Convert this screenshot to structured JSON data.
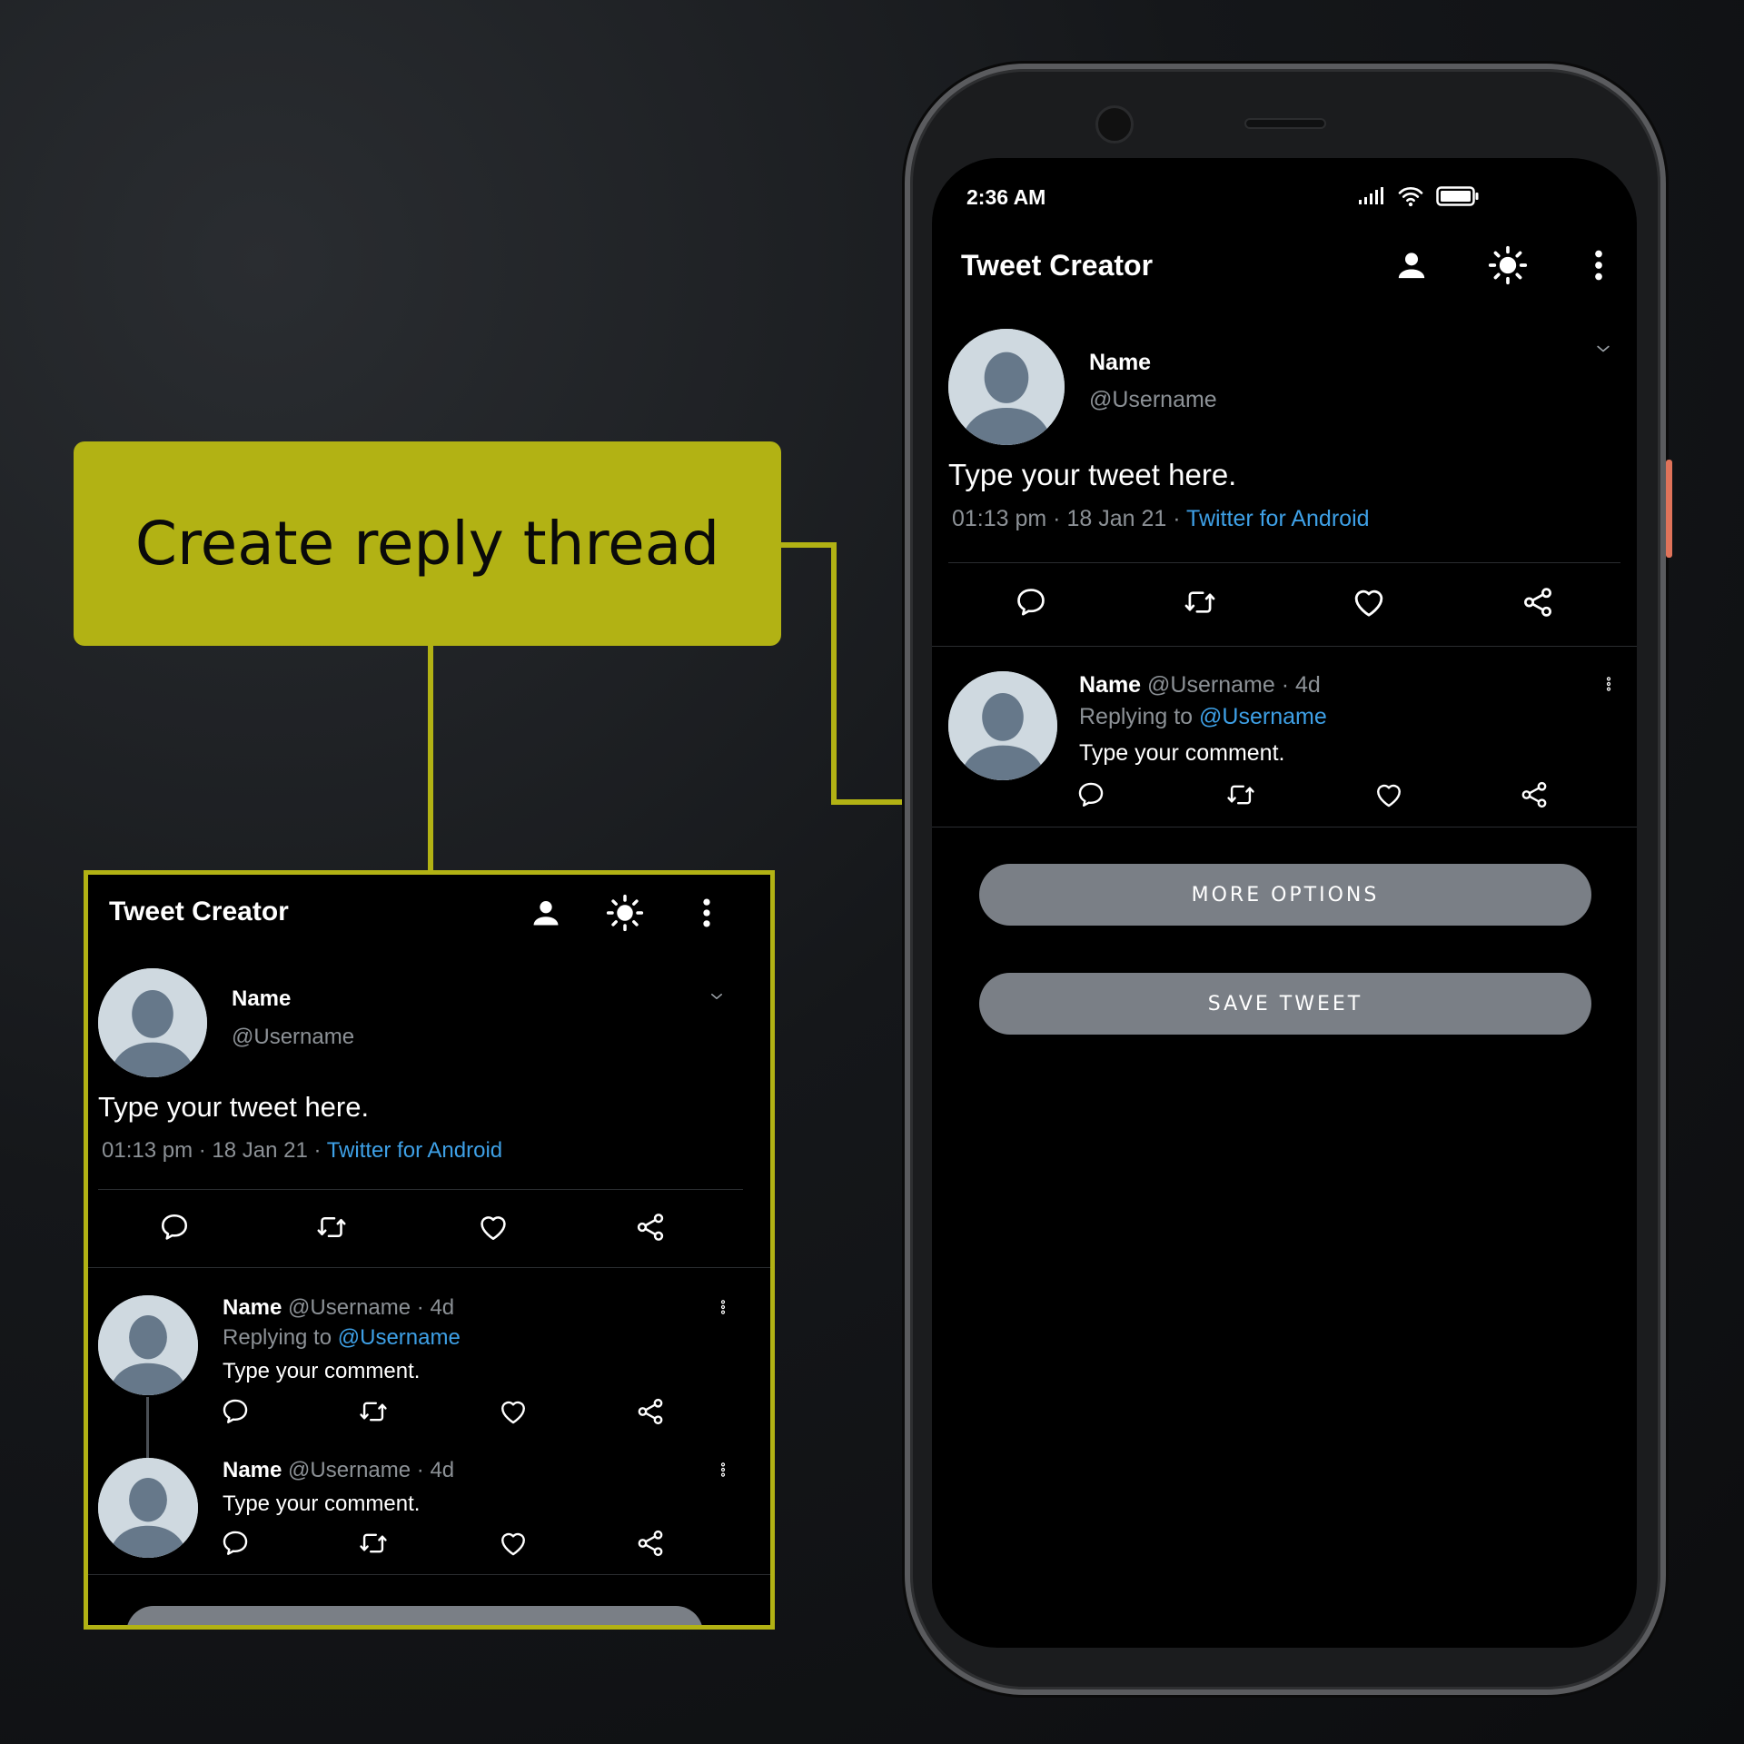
{
  "callout": {
    "text": "Create reply thread"
  },
  "colors": {
    "accent": "#b2b214",
    "link": "#3ea0e6",
    "button": "#7a7f86"
  },
  "status_bar": {
    "time": "2:36 AM"
  },
  "app": {
    "title": "Tweet Creator",
    "toolbar_icons": [
      "person-icon",
      "brightness-icon",
      "more-vert-icon"
    ]
  },
  "main_tweet": {
    "name": "Name",
    "username": "@Username",
    "text": "Type your tweet here.",
    "time": "01:13 pm · 18 Jan 21 · ",
    "source": "Twitter for Android"
  },
  "reply": {
    "name": "Name",
    "meta": "@Username · 4d",
    "replying_prefix": "Replying to ",
    "replying_to": "@Username",
    "text": "Type your comment."
  },
  "thread_reply": {
    "name": "Name",
    "meta": "@Username · 4d",
    "text": "Type your comment."
  },
  "buttons": {
    "more_options": "MORE OPTIONS",
    "save_tweet": "SAVE TWEET"
  },
  "action_icons": [
    "comment-icon",
    "retweet-icon",
    "like-icon",
    "share-icon"
  ]
}
